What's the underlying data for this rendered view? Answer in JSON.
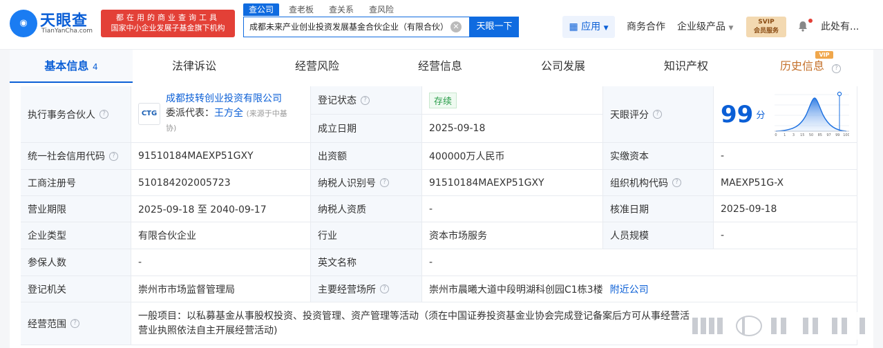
{
  "header": {
    "logo_text": "天眼查",
    "logo_en": "TianYanCha.com",
    "slogan_line1": "都在用的商业查询工具",
    "slogan_line2": "国家中小企业发展子基金旗下机构",
    "search_tabs": [
      "查公司",
      "查老板",
      "查关系",
      "查风险"
    ],
    "search_value": "成都未来产业创业投资发展基金合伙企业（有限合伙）",
    "search_button": "天眼一下",
    "apps_label": "应用",
    "nav": [
      "商务合作",
      "企业级产品"
    ],
    "vip_line1": "SVIP",
    "vip_line2": "会员服务",
    "user_name": "此处有..."
  },
  "tabs": {
    "basic": "基本信息",
    "basic_count": "4",
    "items": [
      "法律诉讼",
      "经营风险",
      "经营信息",
      "公司发展",
      "知识产权"
    ],
    "history": "历史信息",
    "vip_tag": "VIP"
  },
  "info": {
    "partner_label": "执行事务合伙人",
    "partner_name": "成都技转创业投资有限公司",
    "partner_logo": "CTG",
    "rep_prefix": "委派代表：",
    "rep_name": "王方全",
    "rep_source_line1": "(来源于中基",
    "rep_source_line2": "协)",
    "reg_status_label": "登记状态",
    "reg_status": "存续",
    "found_date_label": "成立日期",
    "found_date": "2025-09-18",
    "score_label": "天眼评分",
    "score": "99",
    "score_unit": "分",
    "score_axis": [
      "0",
      "1",
      "3",
      "15",
      "50",
      "85",
      "97",
      "99",
      "100"
    ],
    "credit_code_label": "统一社会信用代码",
    "credit_code": "91510184MAEXP51GXY",
    "capital_label": "出资额",
    "capital": "400000万人民币",
    "paid_label": "实缴资本",
    "paid": "-",
    "reg_no_label": "工商注册号",
    "reg_no": "510184202005723",
    "tax_id_label": "纳税人识别号",
    "tax_id": "91510184MAEXP51GXY",
    "org_code_label": "组织机构代码",
    "org_code": "MAEXP51G-X",
    "term_label": "营业期限",
    "term": "2025-09-18 至 2040-09-17",
    "tax_quality_label": "纳税人资质",
    "tax_quality": "-",
    "approve_label": "核准日期",
    "approve": "2025-09-18",
    "type_label": "企业类型",
    "type": "有限合伙企业",
    "industry_label": "行业",
    "industry": "资本市场服务",
    "staff_label": "人员规模",
    "staff": "-",
    "insured_label": "参保人数",
    "insured": "-",
    "en_name_label": "英文名称",
    "en_name": "-",
    "authority_label": "登记机关",
    "authority": "崇州市市场监督管理局",
    "address_label": "主要经营场所",
    "address": "崇州市晨曦大道中段明湖科创园C1栋3楼",
    "nearby": "附近公司",
    "scope_label": "经营范围",
    "scope_line1": "一般项目：以私募基金从事股权投资、投资管理、资产管理等活动（须在中国证券投资基金业协会完成登记备案后方可从事经营活",
    "scope_line2": "营业执照依法自主开展经营活动)"
  },
  "colors": {
    "brand_blue": "#0b5fd6",
    "slogan_red": "#e34037",
    "status_green": "#2a9d4a",
    "history_orange": "#c4702a"
  }
}
